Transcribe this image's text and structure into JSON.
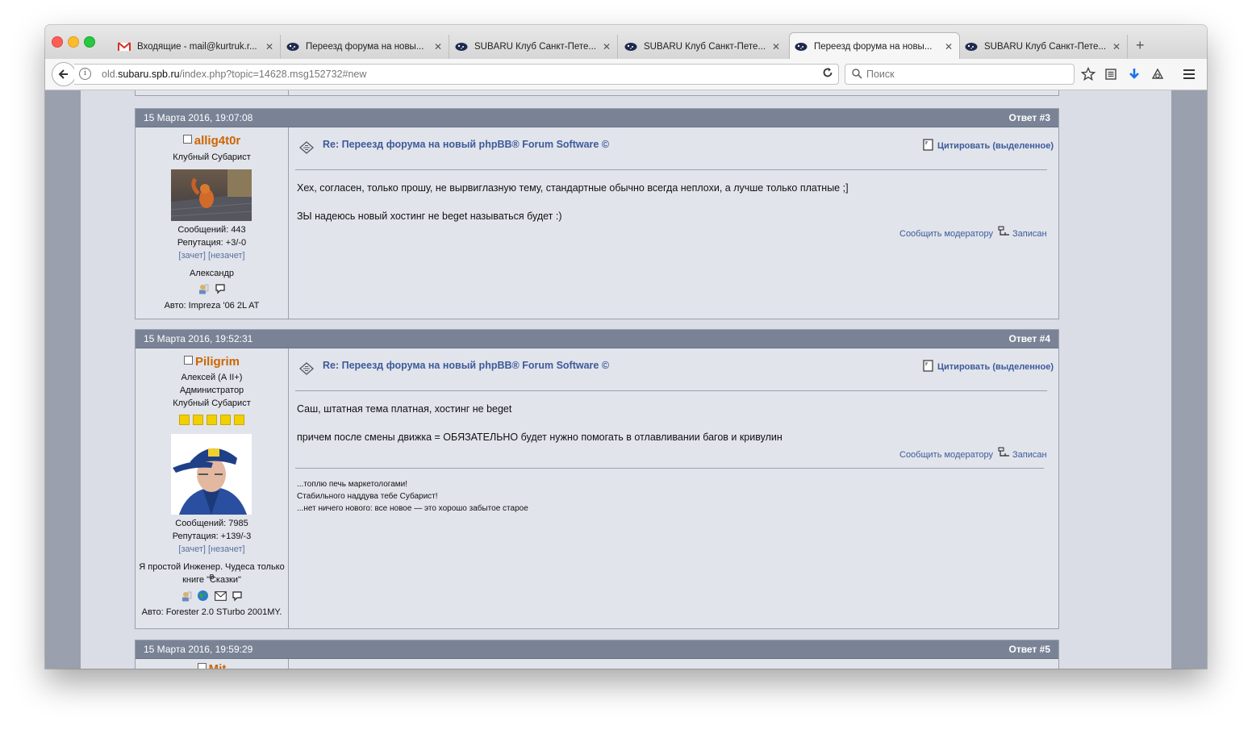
{
  "browser": {
    "tabs": [
      {
        "title": "Входящие - mail@kurtruk.r...",
        "icon": "gmail-icon"
      },
      {
        "title": "Переезд форума на новы...",
        "icon": "subaru-icon"
      },
      {
        "title": "SUBARU Клуб Санкт-Пете...",
        "icon": "subaru-icon"
      },
      {
        "title": "SUBARU Клуб Санкт-Пете...",
        "icon": "subaru-icon"
      },
      {
        "title": "Переезд форума на новы...",
        "icon": "subaru-icon",
        "active": true
      },
      {
        "title": "SUBARU Клуб Санкт-Пете...",
        "icon": "subaru-icon"
      }
    ],
    "new_tab": "+",
    "close": "✕",
    "url_prefix": "old.",
    "url_host": "subaru.spb.ru",
    "url_path": "/index.php?topic=14628.msg152732#new",
    "search_placeholder": "Поиск"
  },
  "posts": [
    {
      "date": "15 Марта 2016, 19:07:08",
      "reply": "Ответ #3",
      "username": "allig4t0r",
      "titles": [
        "Клубный Субарист"
      ],
      "messages_count": "Сообщений: 443",
      "reputation": "Репутация: +3/-0",
      "karma_plus": "[зачет]",
      "karma_minus": "[незачет]",
      "personal_text": "Александр",
      "car": "Авто: Impreza '06 2L AT",
      "subject": "Re: Переезд форума на новый phpBB® Forum Software ©",
      "quote": "Цитировать (выделенное)",
      "body": [
        "Хех, согласен, только прошу, не вырвиглазную тему, стандартные обычно всегда неплохи, а лучше только платные ;]",
        "ЗЫ надеюсь новый хостинг не beget называться будет  :)"
      ],
      "report": "Сообщить модератору",
      "logged": "Записан"
    },
    {
      "date": "15 Марта 2016, 19:52:31",
      "reply": "Ответ #4",
      "username": "Piligrim",
      "titles": [
        "Алексей (А II+)",
        "Администратор",
        "Клубный Субарист"
      ],
      "messages_count": "Сообщений: 7985",
      "reputation": "Репутация: +139/-3",
      "karma_plus": "[зачет]",
      "karma_minus": "[незачет]",
      "personal_text_1": "Я простой Инженер. Чудеса только в",
      "personal_text_2": "книге \"Сказки\"",
      "car": "Авто: Forester 2.0 STurbo 2001MY.",
      "subject": "Re: Переезд форума на новый phpBB® Forum Software ©",
      "quote": "Цитировать (выделенное)",
      "body": [
        "Саш, штатная тема платная, хостинг не beget",
        "причем после смены движка = ОБЯЗАТЕЛЬНО будет нужно помогать в отлавливании багов и кривулин"
      ],
      "report": "Сообщить модератору",
      "logged": "Записан",
      "signature": [
        "...топлю печь маркетологами!",
        "Стабильного наддува тебе Субарист!",
        "...нет ничего нового: все новое — это хорошо забытое старое"
      ],
      "rank_stars": 5
    },
    {
      "date": "15 Марта 2016, 19:59:29",
      "reply": "Ответ #5",
      "username": "Mit"
    }
  ],
  "colors": {
    "header_bar": "#7a8396",
    "username": "#cc6600",
    "link": "#3d5a9a",
    "post_bg": "#e1e4eb"
  }
}
